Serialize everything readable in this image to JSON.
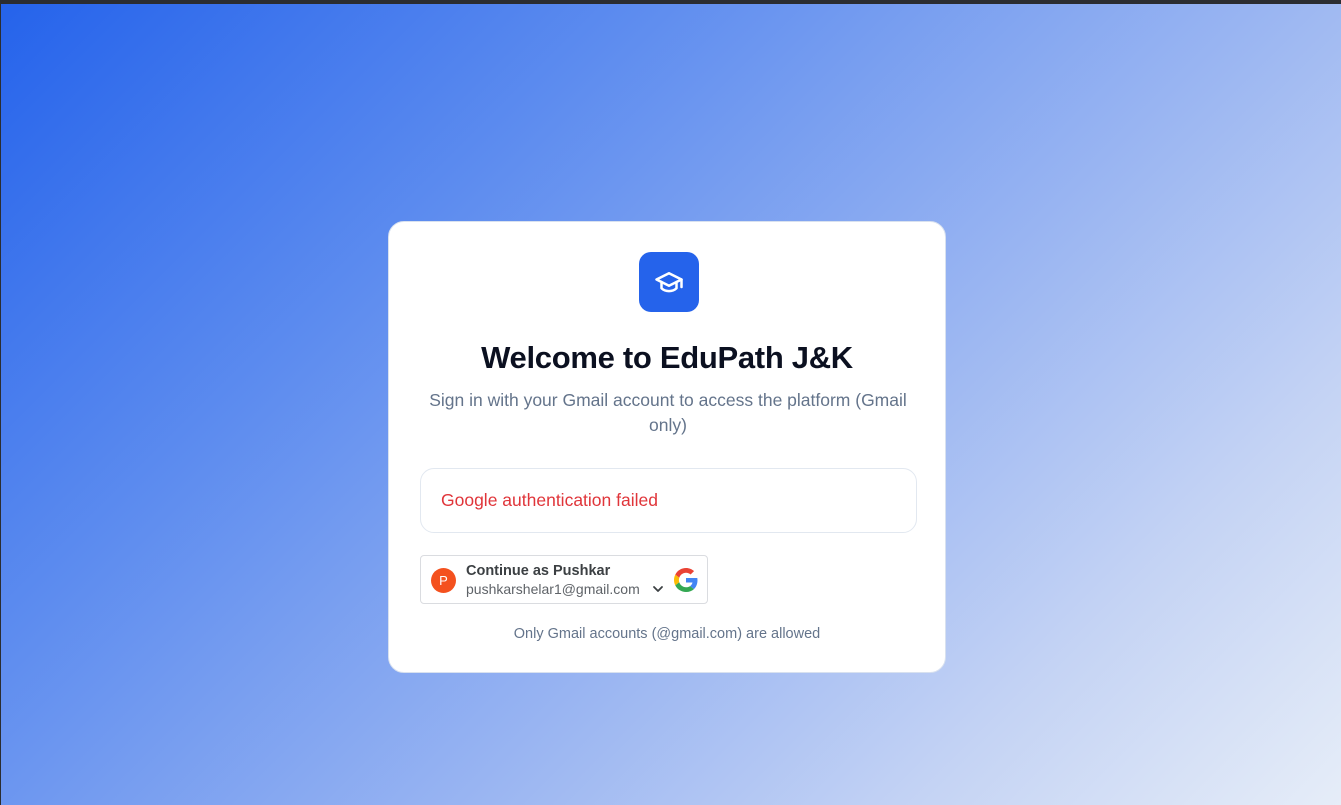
{
  "window": {
    "background_gradient": [
      "#2563eb",
      "#e6edf8"
    ]
  },
  "card": {
    "logo_icon": "graduation-cap-icon",
    "logo_color": "#2563eb",
    "title": "Welcome to EduPath J&K",
    "subtitle": "Sign in with your Gmail account to access the platform (Gmail only)",
    "error_message": "Google authentication failed",
    "error_color": "#e0353a",
    "google_button": {
      "avatar_letter": "P",
      "avatar_color": "#f4511e",
      "label": "Continue as Pushkar",
      "email": "pushkarshelar1@gmail.com",
      "chevron_icon": "chevron-down-icon",
      "brand_icon": "google-icon"
    },
    "footnote": "Only Gmail accounts (@gmail.com) are allowed"
  }
}
